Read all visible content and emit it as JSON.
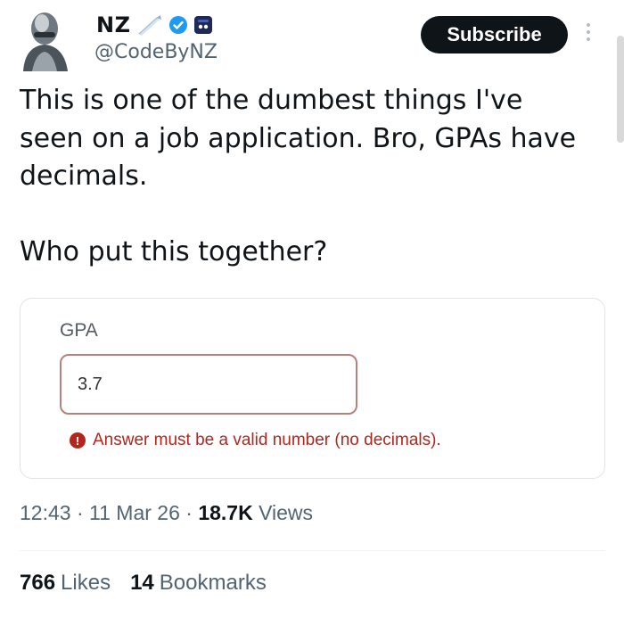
{
  "author": {
    "display_name": "NZ",
    "handle": "@CodeByNZ"
  },
  "header": {
    "subscribe_label": "Subscribe"
  },
  "post": {
    "text": "This is one of the dumbest things I've\nseen on a job application. Bro, GPAs have\ndecimals.\n\nWho put this together?"
  },
  "form_image": {
    "field_label": "GPA",
    "field_value": "3.7",
    "error_message": "Answer must be a valid number (no decimals)."
  },
  "meta": {
    "time": "12:43",
    "date": "11 Mar 26",
    "views_count": "18.7K",
    "views_label": "Views",
    "separator": " · "
  },
  "stats": {
    "likes_count": "766",
    "likes_label": "Likes",
    "bookmarks_count": "14",
    "bookmarks_label": "Bookmarks"
  },
  "icons": {
    "verified": "verified-badge-icon",
    "more": "more-options-icon"
  },
  "colors": {
    "verified_blue": "#1d9bf0",
    "error_red": "#b3261e",
    "button_bg": "#0f1419"
  }
}
